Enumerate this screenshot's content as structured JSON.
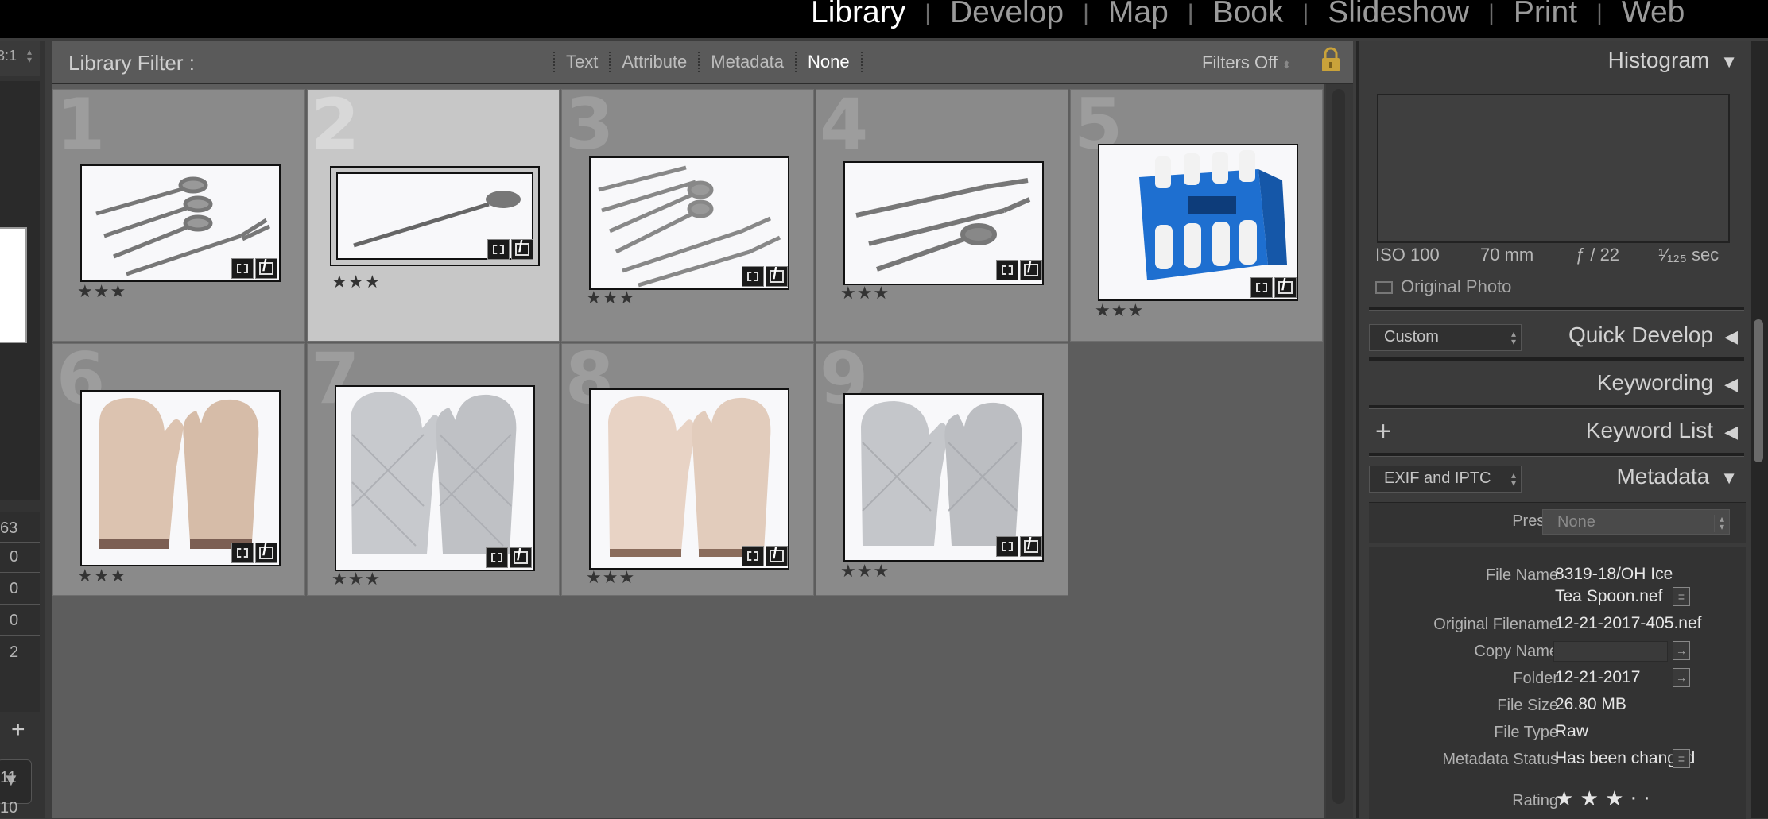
{
  "modules": [
    "Library",
    "Develop",
    "Map",
    "Book",
    "Slideshow",
    "Print",
    "Web"
  ],
  "active_module": "Library",
  "left_panel": {
    "zoom_label": "3:1",
    "counts": [
      "63",
      "0",
      "0",
      "0",
      "2"
    ],
    "plus_label": "+",
    "collapse_label": "▼",
    "bottom_counts": [
      "11",
      "10"
    ]
  },
  "filter_bar": {
    "title": "Library Filter :",
    "options": [
      "Text",
      "Attribute",
      "Metadata",
      "None"
    ],
    "active_option": "None",
    "preset": "Filters Off"
  },
  "grid": {
    "cells": [
      {
        "index": "1",
        "stars": "★★★",
        "subject": "spoons-fork"
      },
      {
        "index": "2",
        "stars": "★★★",
        "subject": "ice-tea-spoon",
        "selected": true
      },
      {
        "index": "3",
        "stars": "★★★",
        "subject": "flatware-set"
      },
      {
        "index": "4",
        "stars": "★★★",
        "subject": "knife-fork-spoon"
      },
      {
        "index": "5",
        "stars": "★★★",
        "subject": "squeeze-bottles-box"
      },
      {
        "index": "6",
        "stars": "★★★",
        "subject": "beige-oven-mitts"
      },
      {
        "index": "7",
        "stars": "★★★",
        "subject": "silver-oven-mitts"
      },
      {
        "index": "8",
        "stars": "★★★",
        "subject": "beige-oven-mitts"
      },
      {
        "index": "9",
        "stars": "★★★",
        "subject": "silver-oven-mitts"
      }
    ]
  },
  "right_panel": {
    "histogram": {
      "title": "Histogram",
      "iso": "ISO 100",
      "focal": "70 mm",
      "aperture": "ƒ / 22",
      "shutter": "¹⁄₁₂₅ sec",
      "original_photo": "Original Photo"
    },
    "quick_develop": {
      "title": "Quick Develop",
      "preset": "Custom"
    },
    "keywording": {
      "title": "Keywording"
    },
    "keyword_list": {
      "title": "Keyword List",
      "plus": "+"
    },
    "metadata": {
      "title": "Metadata",
      "view": "EXIF and IPTC",
      "preset_label": "Preset",
      "preset_value": "None",
      "fields": {
        "file_name_label": "File Name",
        "file_name_line1": "8319-18/OH Ice",
        "file_name_line2": "Tea Spoon.nef",
        "original_filename_label": "Original Filename",
        "original_filename": "12-21-2017-405.nef",
        "copy_name_label": "Copy Name",
        "copy_name": "",
        "folder_label": "Folder",
        "folder": "12-21-2017",
        "file_size_label": "File Size",
        "file_size": "26.80 MB",
        "file_type_label": "File Type",
        "file_type": "Raw",
        "metadata_status_label": "Metadata Status",
        "metadata_status": "Has been changed",
        "rating_label": "Rating",
        "rating": "★ ★ ★  ·  ·"
      }
    }
  }
}
